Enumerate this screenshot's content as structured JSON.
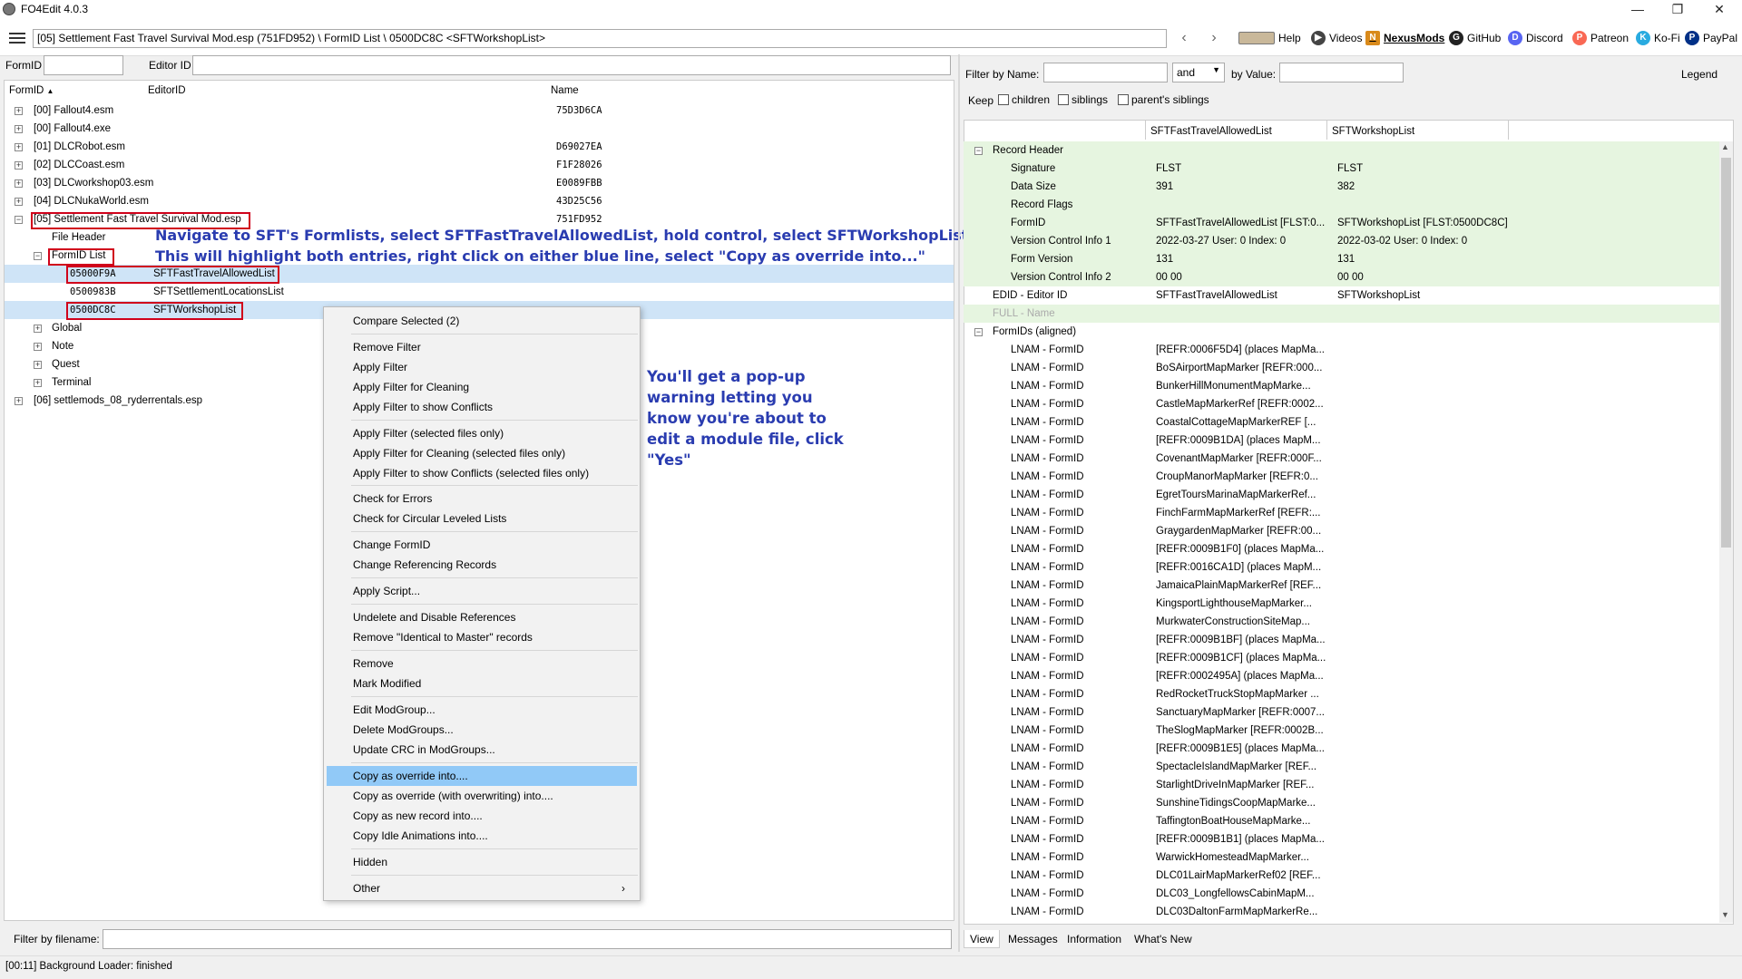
{
  "window": {
    "title": "FO4Edit 4.0.3"
  },
  "path": "[05] Settlement Fast Travel Survival Mod.esp (751FD952) \\ FormID List \\ 0500DC8C <SFTWorkshopList>",
  "top_links": [
    {
      "label": "Help",
      "icon": "help-icon"
    },
    {
      "label": "Videos",
      "icon": "videos-icon"
    },
    {
      "label": "NexusMods",
      "icon": "nexusmods-icon"
    },
    {
      "label": "GitHub",
      "icon": "github-icon"
    },
    {
      "label": "Discord",
      "icon": "discord-icon"
    },
    {
      "label": "Patreon",
      "icon": "patreon-icon"
    },
    {
      "label": "Ko-Fi",
      "icon": "kofi-icon"
    },
    {
      "label": "PayPal",
      "icon": "paypal-icon"
    }
  ],
  "left_filters": {
    "formid_label": "FormID",
    "editorid_label": "Editor ID"
  },
  "tree": {
    "headers": [
      "FormID",
      "EditorID",
      "Name"
    ],
    "rows": [
      {
        "c0": "[00] Fallout4.esm",
        "c1": "",
        "c2": "75D3D6CA"
      },
      {
        "c0": "[00] Fallout4.exe",
        "c1": "",
        "c2": ""
      },
      {
        "c0": "[01] DLCRobot.esm",
        "c1": "",
        "c2": "D69027EA"
      },
      {
        "c0": "[02] DLCCoast.esm",
        "c1": "",
        "c2": "F1F28026"
      },
      {
        "c0": "[03] DLCworkshop03.esm",
        "c1": "",
        "c2": "E0089FBB"
      },
      {
        "c0": "[04] DLCNukaWorld.esm",
        "c1": "",
        "c2": "43D25C56"
      },
      {
        "c0": "[05] Settlement Fast Travel Survival Mod.esp",
        "c1": "",
        "c2": "751FD952"
      },
      {
        "c0": "File Header",
        "c1": "",
        "c2": ""
      },
      {
        "c0": "FormID List",
        "c1": "",
        "c2": ""
      },
      {
        "c0": "05000F9A",
        "c1": "SFTFastTravelAllowedList",
        "c2": ""
      },
      {
        "c0": "0500983B",
        "c1": "SFTSettlementLocationsList",
        "c2": ""
      },
      {
        "c0": "0500DC8C",
        "c1": "SFTWorkshopList",
        "c2": ""
      },
      {
        "c0": "Global",
        "c1": "",
        "c2": ""
      },
      {
        "c0": "Note",
        "c1": "",
        "c2": ""
      },
      {
        "c0": "Quest",
        "c1": "",
        "c2": ""
      },
      {
        "c0": "Terminal",
        "c1": "",
        "c2": ""
      },
      {
        "c0": "[06] settlemods_08_ryderrentals.esp",
        "c1": "",
        "c2": ""
      }
    ]
  },
  "annotations": {
    "top_line1": "Navigate to SFT's Formlists, select SFTFastTravelAllowedList, hold control, select SFTWorkshopList.",
    "top_line2": "This will highlight both entries, right click on either blue line, select \"Copy as override into...\"",
    "side_lines": [
      "You'll get a pop-up",
      "warning letting you",
      "know you're about to",
      "edit a module file, click",
      "\"Yes\""
    ]
  },
  "context_menu": [
    "Compare Selected (2)",
    "Remove Filter",
    "Apply Filter",
    "Apply Filter for Cleaning",
    "Apply Filter to show Conflicts",
    "Apply Filter (selected files only)",
    "Apply Filter for Cleaning (selected files only)",
    "Apply Filter to show Conflicts (selected files only)",
    "Check for Errors",
    "Check for Circular Leveled Lists",
    "Change FormID",
    "Change Referencing Records",
    "Apply Script...",
    "Undelete and Disable References",
    "Remove \"Identical to Master\" records",
    "Remove",
    "Mark Modified",
    "Edit ModGroup...",
    "Delete ModGroups...",
    "Update CRC in ModGroups...",
    "Copy as override into....",
    "Copy as override (with overwriting) into....",
    "Copy as new record into....",
    "Copy Idle Animations into....",
    "Hidden",
    "Other"
  ],
  "filename_filter_label": "Filter by filename:",
  "status": "[00:11] Background Loader: finished",
  "right_filters": {
    "by_name_label": "Filter by Name:",
    "op_value": "and",
    "by_value_label": "by Value:",
    "legend": "Legend",
    "keep_label": "Keep",
    "children_label": "children",
    "siblings_label": "siblings",
    "parents_siblings_label": "parent's siblings"
  },
  "records": {
    "col_headers": [
      "SFTFastTravelAllowedList",
      "SFTWorkshopList"
    ],
    "rows": [
      {
        "label": "Record Header",
        "v1": "",
        "v2": ""
      },
      {
        "label": "Signature",
        "v1": "FLST",
        "v2": "FLST"
      },
      {
        "label": "Data Size",
        "v1": "391",
        "v2": "382"
      },
      {
        "label": "Record Flags",
        "v1": "",
        "v2": ""
      },
      {
        "label": "FormID",
        "v1": "SFTFastTravelAllowedList [FLST:0...",
        "v2": "SFTWorkshopList [FLST:0500DC8C]"
      },
      {
        "label": "Version Control Info 1",
        "v1": "2022-03-27 User: 0 Index: 0",
        "v2": "2022-03-02 User: 0 Index: 0"
      },
      {
        "label": "Form Version",
        "v1": "131",
        "v2": "131"
      },
      {
        "label": "Version Control Info 2",
        "v1": "00 00",
        "v2": "00 00"
      },
      {
        "label": "EDID - Editor ID",
        "v1": "SFTFastTravelAllowedList",
        "v2": "SFTWorkshopList"
      },
      {
        "label": "FULL - Name",
        "v1": "",
        "v2": ""
      },
      {
        "label": "FormIDs (aligned)",
        "v1": "",
        "v2": ""
      }
    ],
    "lnam_label": "LNAM - FormID",
    "lnam_values": [
      "[REFR:0006F5D4] (places MapMa...",
      "BoSAirportMapMarker [REFR:000...",
      "BunkerHillMonumentMapMarke...",
      "CastleMapMarkerRef [REFR:0002...",
      "CoastalCottageMapMarkerREF [...",
      "[REFR:0009B1DA] (places MapM...",
      "CovenantMapMarker [REFR:000F...",
      "CroupManorMapMarker [REFR:0...",
      "EgretToursMarinaMapMarkerRef...",
      "FinchFarmMapMarkerRef [REFR:...",
      "GraygardenMapMarker [REFR:00...",
      "[REFR:0009B1F0] (places MapMa...",
      "[REFR:0016CA1D] (places MapM...",
      "JamaicaPlainMapMarkerRef [REF...",
      "KingsportLighthouseMapMarker...",
      "MurkwaterConstructionSiteMap...",
      "[REFR:0009B1BF] (places MapMa...",
      "[REFR:0009B1CF] (places MapMa...",
      "[REFR:0002495A] (places MapMa...",
      "RedRocketTruckStopMapMarker ...",
      "SanctuaryMapMarker [REFR:0007...",
      "TheSlogMapMarker [REFR:0002B...",
      "[REFR:0009B1E5] (places MapMa...",
      "SpectacleIslandMapMarker [REF...",
      "StarlightDriveInMapMarker [REF...",
      "SunshineTidingsCoopMapMarke...",
      "TaffingtonBoatHouseMapMarke...",
      "[REFR:0009B1B1] (places MapMa...",
      "WarwickHomesteadMapMarker...",
      "DLC01LairMapMarkerRef02 [REF...",
      "DLC03_LongfellowsCabinMapM...",
      "DLC03DaltonFarmMapMarkerRe..."
    ]
  },
  "bottom_tabs": [
    "View",
    "Messages",
    "Information",
    "What's New"
  ],
  "colors": {
    "selection": "#cfe4f7",
    "menu_highlight": "#91c9f7",
    "annotation": "#2a3cb0",
    "red_box": "#d0021b",
    "green_row": "#e6f5e0"
  }
}
